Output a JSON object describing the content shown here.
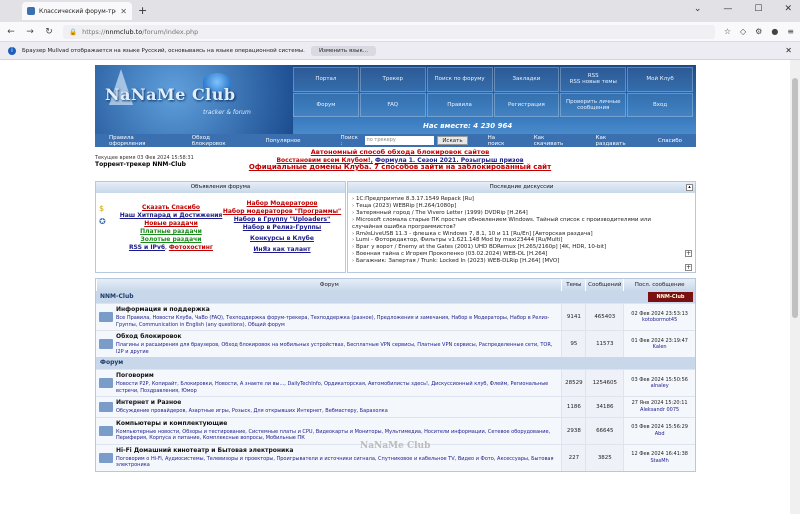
{
  "browser": {
    "tab_title": "Классический форум-трекер NNM",
    "url_scheme": "https://",
    "url_host": "nnmclub.to",
    "url_path": "/forum/index.php"
  },
  "notification": {
    "text": "Браузер Mullvad отображается на языке Русский, основываясь на языке операционной системы.",
    "button": "Изменить язык..."
  },
  "site": {
    "logo_main": "NaNaMe Club",
    "logo_sub": "tracker & forum",
    "online": "Нас вместе: 4 230 964",
    "topnav": [
      "Портал",
      "Трекер",
      "Поиск по форуму",
      "Закладки",
      "RSS\nRSS новые темы",
      "Мой Клуб",
      "Форум",
      "FAQ",
      "Правила",
      "Регистрация",
      "Проверить личные сообщения",
      "Вход"
    ],
    "toolbar": [
      "Правила оформления",
      "Обход блокировок",
      "Популярное"
    ],
    "search_label": "Поиск :",
    "search_placeholder": "по трекеру",
    "search_button": "Искать",
    "toolbar_right": [
      "На поиск",
      "Как скачивать",
      "Как раздавать",
      "Спасибо"
    ],
    "time": "Текущее время 03 Фев 2024 15:58:31",
    "tracker": "Торрент-трекер NNM-Club",
    "announce1": "Автономный способ обхода блокировок сайтов",
    "announce2a": "Восстановим всем Клубом!,",
    "announce2b": "Формула 1. Сезон 2021. Розыгрыш призов",
    "announce3": "Официальные домены Клуба. 7 способов зайти на заблокированный сайт"
  },
  "announcements": {
    "title": "Объявления форума",
    "col1": [
      {
        "t": "Сказать Спасибо",
        "c": "red"
      },
      {
        "t": "Наш Хитпарад и Достижения",
        "c": "blu"
      },
      {
        "t": "Новые раздачи",
        "c": "red"
      },
      {
        "t": "Платные раздачи",
        "c": "grn"
      },
      {
        "t": "Золотые раздачи",
        "c": "grn"
      },
      {
        "t": "RSS и IPv6",
        "c": "blu"
      }
    ],
    "col1b": "Фотохостинг",
    "col2": [
      {
        "t": "Набор Модераторов",
        "c": "red"
      },
      {
        "t": "Набор модераторов \"Программы\"",
        "c": "red"
      },
      {
        "t": "Набор в Группу \"Uploaders\"",
        "c": "blu"
      },
      {
        "t": "Набор в Релиз-Группы",
        "c": "blu"
      },
      {
        "t": "Конкурсы в Клубе",
        "c": "blu"
      },
      {
        "t": "ИнЯз как талант",
        "c": "blu"
      }
    ]
  },
  "discussions": {
    "title": "Последние дискуссии",
    "items": [
      "1С:Предприятие 8.3.17.1549 Repack [Ru]",
      "Теща (2023) WEBRip [H.264/1080p]",
      "Затерянный город / The Vivero Letter (1999) DVDRip [H.264]",
      "Microsoft сломала старые ПК простым обновлением Windows. Тайный список с производителями или случайная ошибка программистов?",
      "Rm∂sLiveUSB 11.3 - флешка с Windows 7, 8.1, 10 и 11 [Ru/En] [Авторская раздача]",
      "Lumi - Фоторедактор, Фильтры v1.621.148 Mod by maxi23444 [Ru/Multi]",
      "Враг у ворот / Enemy at the Gates (2001) UHD BDRemux [H.265/2160p] [4K, HDR, 10-bit]",
      "Военная тайна с Игорем Прокопенко (03.02.2024) WEB-DL [H.264]",
      "Багажник: Запертая / Trunk: Locked In (2023) WEB-DLRip [H.264] [MVO]"
    ]
  },
  "forum": {
    "headers": [
      "Форум",
      "Темы",
      "Сообщений",
      "Посл. сообщение"
    ],
    "cat1": "NNM-Club",
    "cat2": "Форум",
    "rows": [
      {
        "name": "Информация и поддержка",
        "subs": "Все Правила,  Новости Клуба,  ЧаВо (FAQ),  Техподдержка форум-трекера,  Техподдержка (разное),  Предложения и замечания,  Набор в Модераторы,  Набор в Релиз-Группы,  Communication in English (any questions),  Общий форум",
        "topics": "9141",
        "posts": "465403",
        "date": "02 Фев 2024 23:53:13",
        "user": "kotobormot45"
      },
      {
        "name": "Обход блокировок",
        "subs": "Плагины и расширения для браузеров,  Обход блокировок на мобильных устройствах,  Бесплатные VPN сервисы,  Платные VPN сервисы,  Распределенные сети, TOR, I2P и другие",
        "topics": "95",
        "posts": "11573",
        "date": "01 Фев 2024 23:19:47",
        "user": "Kalen"
      },
      {
        "name": "Поговорим",
        "subs": "Новости P2P, Копирайт, Блокировки,  Новости,  А знаете ли вы...,  DailyTechInfo,  Ордикаторская,  Автомобилисты здесь!,  Дискуссионный клуб,  Флейм,  Региональные встречи,  Поздравления,  Юмор",
        "topics": "28529",
        "posts": "1254605",
        "date": "03 Фев 2024 15:50:56",
        "user": "alnaley"
      },
      {
        "name": "Интернет и Разное",
        "subs": "Обсуждение провайдеров,  Азартные игры,  Розыск,  Для открывших Интернет,  Вебмастеру,  Барахолка",
        "topics": "1186",
        "posts": "34186",
        "date": "27 Янв 2024 15:20:11",
        "user": "Aleksandr 0075"
      },
      {
        "name": "Компьютеры и комплектующие",
        "subs": "Компьютерные новости,  Обзоры и тестирование,  Системные платы и CPU,  Видеокарты и Мониторы,  Мультимедиа,  Носители информации,  Сетевое оборудование,  Периферия,  Корпуса и питание,  Комплексные вопросы,  Мобильные ПК",
        "topics": "2938",
        "posts": "66645",
        "date": "03 Фев 2024 15:56:29",
        "user": "Abd"
      },
      {
        "name": "Hi-Fi Домашний кинотеатр и Бытовая электроника",
        "subs": "Поговорим о Hi-Fi,  Аудиосистемы,  Телевизоры и проекторы,  Проигрыватели и источники сигнала,  Спутниковое и кабельное TV,  Видео и Фото,  Аксессуары,  Бытовая электроника",
        "topics": "227",
        "posts": "3825",
        "date": "12 Фев 2024 16:41:38",
        "user": "StasMh"
      }
    ]
  },
  "footer_logo": "NaNaMe Club"
}
